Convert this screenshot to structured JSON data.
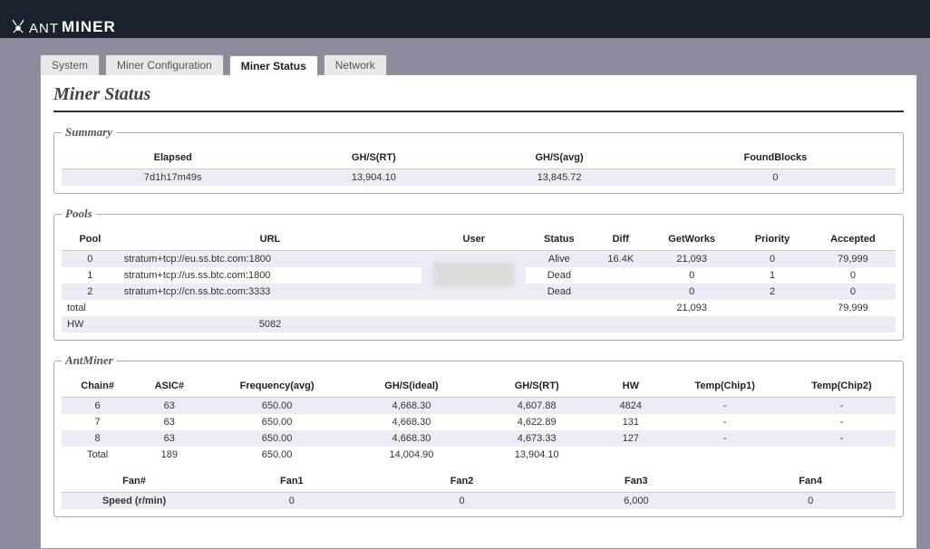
{
  "brand": {
    "part1": "ANT",
    "part2": "MINER"
  },
  "tabs": [
    {
      "label": "System",
      "active": false
    },
    {
      "label": "Miner Configuration",
      "active": false
    },
    {
      "label": "Miner Status",
      "active": true
    },
    {
      "label": "Network",
      "active": false
    }
  ],
  "page_title": "Miner Status",
  "summary": {
    "legend": "Summary",
    "headers": {
      "elapsed": "Elapsed",
      "ghs_rt": "GH/S(RT)",
      "ghs_avg": "GH/S(avg)",
      "found": "FoundBlocks"
    },
    "row": {
      "elapsed": "7d1h17m49s",
      "ghs_rt": "13,904.10",
      "ghs_avg": "13,845.72",
      "found": "0"
    }
  },
  "pools": {
    "legend": "Pools",
    "headers": {
      "pool": "Pool",
      "url": "URL",
      "user": "User",
      "status": "Status",
      "diff": "Diff",
      "getworks": "GetWorks",
      "priority": "Priority",
      "accepted": "Accepted"
    },
    "rows": [
      {
        "pool": "0",
        "url": "stratum+tcp://eu.ss.btc.com:1800",
        "user": "",
        "status": "Alive",
        "diff": "16.4K",
        "getworks": "21,093",
        "priority": "0",
        "accepted": "79,999"
      },
      {
        "pool": "1",
        "url": "stratum+tcp://us.ss.btc.com:1800",
        "user": "",
        "status": "Dead",
        "diff": "",
        "getworks": "0",
        "priority": "1",
        "accepted": "0"
      },
      {
        "pool": "2",
        "url": "stratum+tcp://cn.ss.btc.com:3333",
        "user": "",
        "status": "Dead",
        "diff": "",
        "getworks": "0",
        "priority": "2",
        "accepted": "0"
      }
    ],
    "total": {
      "label": "total",
      "getworks": "21,093",
      "accepted": "79,999"
    },
    "hw": {
      "label": "HW",
      "value": "5082"
    }
  },
  "antminer": {
    "legend": "AntMiner",
    "chains": {
      "headers": {
        "chain": "Chain#",
        "asic": "ASIC#",
        "freq": "Frequency(avg)",
        "ideal": "GH/S(ideal)",
        "rt": "GH/S(RT)",
        "hw": "HW",
        "t1": "Temp(Chip1)",
        "t2": "Temp(Chip2)"
      },
      "rows": [
        {
          "chain": "6",
          "asic": "63",
          "freq": "650.00",
          "ideal": "4,668.30",
          "rt": "4,607.88",
          "hw": "4824",
          "t1": "-",
          "t2": "-"
        },
        {
          "chain": "7",
          "asic": "63",
          "freq": "650.00",
          "ideal": "4,668.30",
          "rt": "4,622.89",
          "hw": "131",
          "t1": "-",
          "t2": "-"
        },
        {
          "chain": "8",
          "asic": "63",
          "freq": "650.00",
          "ideal": "4,668.30",
          "rt": "4,673.33",
          "hw": "127",
          "t1": "-",
          "t2": "-"
        }
      ],
      "total": {
        "label": "Total",
        "asic": "189",
        "freq": "650.00",
        "ideal": "14,004.90",
        "rt": "13,904.10"
      }
    },
    "fans": {
      "headers": {
        "fan": "Fan#",
        "f1": "Fan1",
        "f2": "Fan2",
        "f3": "Fan3",
        "f4": "Fan4"
      },
      "row": {
        "label": "Speed (r/min)",
        "f1": "0",
        "f2": "0",
        "f3": "6,000",
        "f4": "0"
      }
    }
  }
}
